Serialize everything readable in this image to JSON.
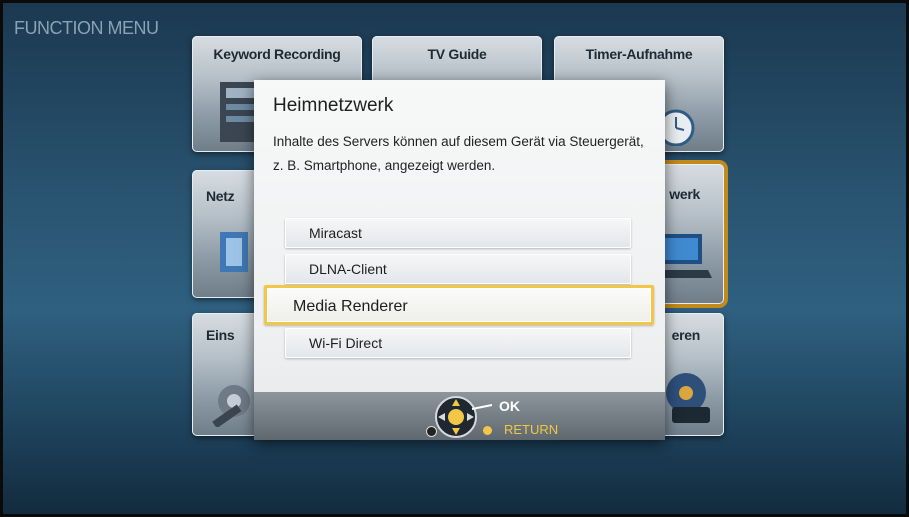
{
  "header": {
    "title": "FUNCTION MENU"
  },
  "tiles": [
    {
      "label": "Keyword Recording"
    },
    {
      "label": "TV Guide"
    },
    {
      "label": "Timer-Aufnahme"
    },
    {
      "label": "Netz"
    },
    {
      "label": "werk"
    },
    {
      "label": "Eins"
    },
    {
      "label": "eren"
    }
  ],
  "dialog": {
    "title": "Heimnetzwerk",
    "description": "Inhalte des Servers können auf diesem Gerät via Steuergerät, z. B. Smartphone, angezeigt werden.",
    "options": [
      {
        "label": "Miracast"
      },
      {
        "label": "DLNA-Client"
      },
      {
        "label": "Media Renderer"
      },
      {
        "label": "Wi-Fi Direct"
      }
    ],
    "selected_option": "Media Renderer",
    "footer": {
      "ok_label": "OK",
      "return_label": "RETURN"
    }
  },
  "colors": {
    "highlight": "#f2c646",
    "selected_tile_border": "#c28a1a"
  }
}
